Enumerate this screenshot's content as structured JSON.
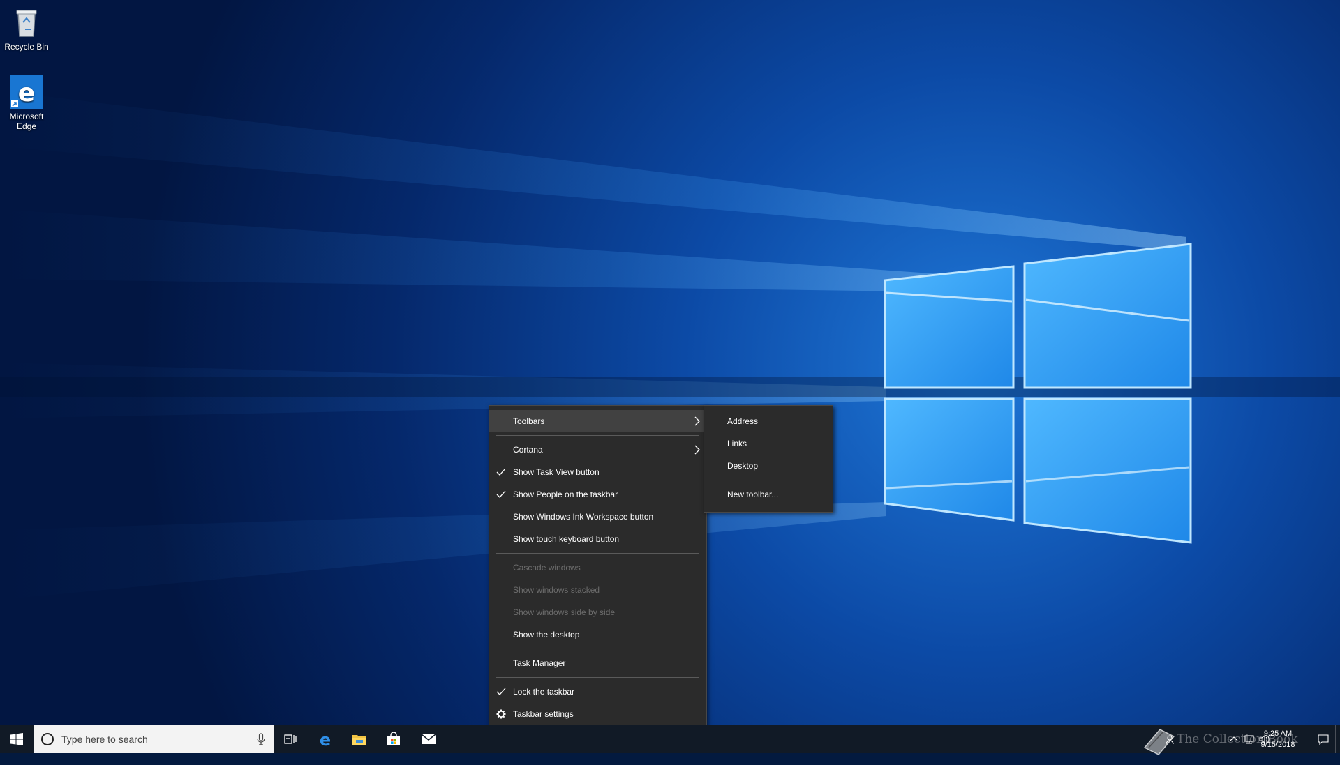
{
  "desktop": {
    "icons": [
      {
        "label": "Recycle Bin",
        "icon": "recycle-bin-icon"
      },
      {
        "label": "Microsoft Edge",
        "icon": "edge-icon"
      }
    ]
  },
  "context_menu": {
    "items": [
      {
        "label": "Toolbars",
        "submenu": true,
        "highlighted": true
      },
      {
        "label": "Cortana",
        "submenu": true
      },
      {
        "label": "Show Task View button",
        "checked": true
      },
      {
        "label": "Show People on the taskbar",
        "checked": true
      },
      {
        "label": "Show Windows Ink Workspace button"
      },
      {
        "label": "Show touch keyboard button"
      },
      {
        "label": "Cascade windows",
        "disabled": true
      },
      {
        "label": "Show windows stacked",
        "disabled": true
      },
      {
        "label": "Show windows side by side",
        "disabled": true
      },
      {
        "label": "Show the desktop"
      },
      {
        "label": "Task Manager"
      },
      {
        "label": "Lock the taskbar",
        "checked": true
      },
      {
        "label": "Taskbar settings",
        "icon": "gear-icon"
      }
    ]
  },
  "toolbars_submenu": {
    "items": [
      {
        "label": "Address"
      },
      {
        "label": "Links"
      },
      {
        "label": "Desktop"
      },
      {
        "label": "New toolbar..."
      }
    ]
  },
  "taskbar": {
    "search_placeholder": "Type here to search",
    "pinned": [
      "task-view-icon",
      "edge-icon",
      "file-explorer-icon",
      "store-icon",
      "mail-icon"
    ],
    "clock": {
      "time": "9:25 AM",
      "date": "9/15/2018"
    }
  },
  "watermark": "The Collection Book",
  "colors": {
    "menu_bg": "#2b2b2b",
    "menu_highlight": "#414141",
    "taskbar_bg": "#111a26",
    "accent": "#0078d7"
  }
}
